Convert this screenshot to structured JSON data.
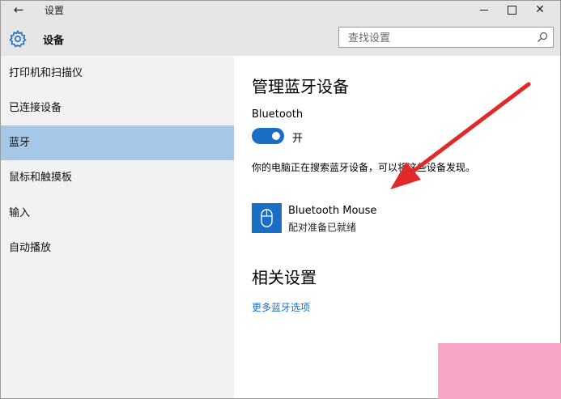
{
  "window": {
    "title": "设置",
    "back_glyph": "←",
    "close_glyph": "✕"
  },
  "header": {
    "title": "设备",
    "search": {
      "placeholder": "查找设置",
      "value": ""
    }
  },
  "sidebar": {
    "items": [
      {
        "label": "打印机和扫描仪",
        "selected": false
      },
      {
        "label": "已连接设备",
        "selected": false
      },
      {
        "label": "蓝牙",
        "selected": true
      },
      {
        "label": "鼠标和触摸板",
        "selected": false
      },
      {
        "label": "输入",
        "selected": false
      },
      {
        "label": "自动播放",
        "selected": false
      }
    ]
  },
  "main": {
    "heading": "管理蓝牙设备",
    "bluetooth_label": "Bluetooth",
    "toggle": {
      "on": true,
      "state_label": "开"
    },
    "status_text": "你的电脑正在搜索蓝牙设备，可以将这些设备发现。",
    "device": {
      "name": "Bluetooth Mouse",
      "status": "配对准备已就绪",
      "icon": "mouse-icon"
    },
    "related_heading": "相关设置",
    "more_link": "更多蓝牙选项"
  },
  "colors": {
    "accent": "#1a6fc4",
    "selected_nav": "#a5c8e8",
    "sidebar_bg": "#f2f2f2",
    "titlebar_bg": "#e6e6e6",
    "annotation_arrow": "#e02a2a",
    "corner_patch": "#f7a6c6"
  }
}
